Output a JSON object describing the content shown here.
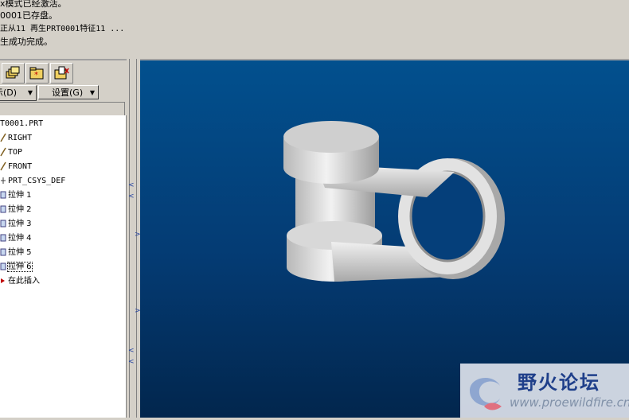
{
  "messages": [
    "x模式已经激活。",
    "0001已存盘。",
    "正从11 再生PRT0001特征11 ...",
    "生成功完成。"
  ],
  "menus": {
    "show_label": "示(D)",
    "settings_label": "设置(G)"
  },
  "tree": {
    "items": [
      {
        "label": "T0001.PRT",
        "icon": "none"
      },
      {
        "label": "RIGHT",
        "icon": "datum-plane-icon"
      },
      {
        "label": "TOP",
        "icon": "datum-plane-icon"
      },
      {
        "label": "FRONT",
        "icon": "datum-plane-icon"
      },
      {
        "label": "PRT_CSYS_DEF",
        "icon": "csys-icon"
      },
      {
        "label": "拉伸 1",
        "icon": "extrude-icon"
      },
      {
        "label": "拉伸 2",
        "icon": "extrude-icon"
      },
      {
        "label": "拉伸 3",
        "icon": "extrude-icon"
      },
      {
        "label": "拉伸 4",
        "icon": "extrude-icon"
      },
      {
        "label": "拉伸 5",
        "icon": "extrude-icon"
      },
      {
        "label": "拉伸 6",
        "icon": "extrude-icon"
      },
      {
        "label": "在此插入",
        "icon": "insert-here-icon"
      }
    ],
    "selected_index": 10
  },
  "watermark": {
    "title": "野火论坛",
    "url": "www.proewildfire.cn"
  },
  "colors": {
    "viewport_top": "#02508e",
    "viewport_bottom": "#02264d",
    "model": "#e0e0e0",
    "insert_marker": "#c00000",
    "watermark_title": "#1f3f8a"
  }
}
